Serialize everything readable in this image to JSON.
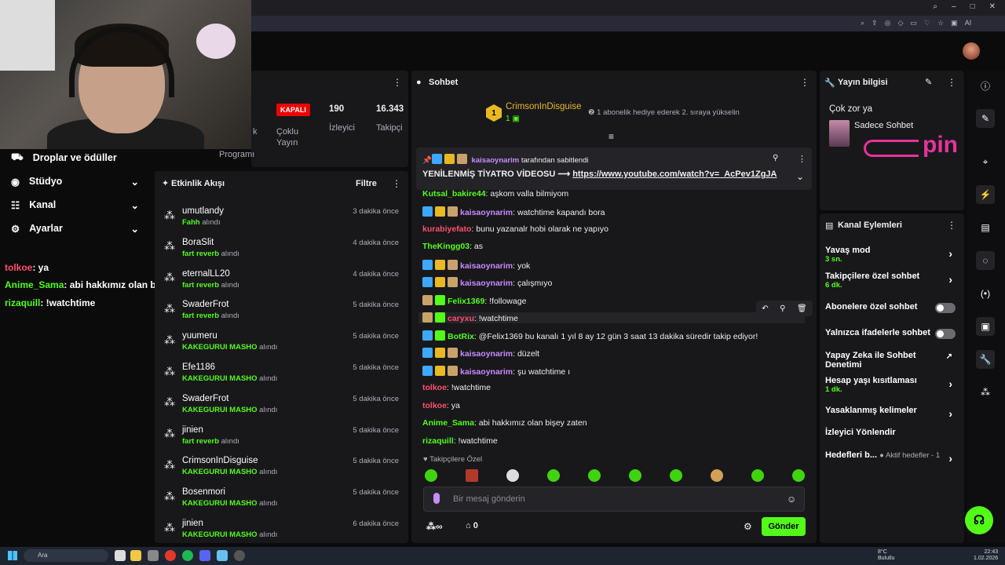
{
  "browser": {
    "window_controls": [
      "–",
      "□",
      "✕"
    ]
  },
  "left_menu": [
    {
      "label": "Droplar ve ödüller"
    },
    {
      "label": "Stüdyo"
    },
    {
      "label": "Kanal"
    },
    {
      "label": "Ayarlar"
    }
  ],
  "overlay_chat": [
    {
      "user": "tolkoe",
      "text": ": ya",
      "color": "#ff4f6b"
    },
    {
      "user": "Anime_Sama",
      "text": ": abi hakkımız olan bişey zaten",
      "color": "#53fc18"
    },
    {
      "user": "rizaquill",
      "text": ": !watchtime",
      "color": "#53fc18"
    }
  ],
  "stats": {
    "status": "KAPALI",
    "viewers_value": "190",
    "viewers_label": "İzleyici",
    "followers_value": "16.343",
    "followers_label": "Takipçi",
    "multi_label": "Çoklu Yayın",
    "program_label": "Programı",
    "partial_k": "k"
  },
  "activity": {
    "title": "Etkinlik Akışı",
    "filter": "Filtre",
    "items": [
      {
        "name": "umutlandy",
        "sub": "Fahh",
        "action": "alındı",
        "time": "3 dakika önce"
      },
      {
        "name": "BoraSlit",
        "sub": "fart reverb",
        "action": "alındı",
        "time": "4 dakika önce"
      },
      {
        "name": "eternalLL20",
        "sub": "fart reverb",
        "action": "alındı",
        "time": "4 dakika önce"
      },
      {
        "name": "SwaderFrot",
        "sub": "fart reverb",
        "action": "alındı",
        "time": "5 dakika önce"
      },
      {
        "name": "yuumeru",
        "sub": "KAKEGURUI MASHO",
        "action": "alındı",
        "time": "5 dakika önce"
      },
      {
        "name": "Efe1186",
        "sub": "KAKEGURUI MASHO",
        "action": "alındı",
        "time": "5 dakika önce"
      },
      {
        "name": "SwaderFrot",
        "sub": "KAKEGURUI MASHO",
        "action": "alındı",
        "time": "5 dakika önce"
      },
      {
        "name": "jinien",
        "sub": "fart reverb",
        "action": "alındı",
        "time": "5 dakika önce"
      },
      {
        "name": "CrimsonInDisguise",
        "sub": "KAKEGURUI MASHO",
        "action": "alındı",
        "time": "5 dakika önce"
      },
      {
        "name": "Bosenmori",
        "sub": "KAKEGURUI MASHO",
        "action": "alındı",
        "time": "5 dakika önce"
      },
      {
        "name": "jinien",
        "sub": "KAKEGURUI MASHO",
        "action": "alındı",
        "time": "6 dakika önce"
      }
    ]
  },
  "chat": {
    "title": "Sohbet",
    "gifter": {
      "rank": "1",
      "name": "CrimsonInDisguise",
      "count": "1",
      "hint": "1 abonelik hediye ederek 2. sıraya yükselin"
    },
    "pinned": {
      "by": "kaisaoynarim",
      "by_suffix": "tarafından sabitlendi",
      "text": "YENİLENMİŞ TİYATRO VİDEOSU ⟶",
      "link": "https://www.youtube.com/watch?v=_AcPev1ZgJA"
    },
    "messages": [
      {
        "user": "Kutsal_bakire44",
        "color": "#53fc18",
        "text": ": aşkom valla bilmiyom",
        "badges": ""
      },
      {
        "user": "kaisaoynarim",
        "color": "#c88bff",
        "text": ": watchtime kapandı bora",
        "badges": "pcs"
      },
      {
        "user": "kurabiyefato",
        "color": "#ff4f6b",
        "text": ": bunu yazanalr hobi olarak ne yapıyo",
        "badges": ""
      },
      {
        "user": "TheKingg03",
        "color": "#53fc18",
        "text": ": as",
        "badges": ""
      },
      {
        "user": "kaisaoynarim",
        "color": "#c88bff",
        "text": ": yok",
        "badges": "pcs"
      },
      {
        "user": "kaisaoynarim",
        "color": "#c88bff",
        "text": ": çalışmıyo",
        "badges": "pcs"
      },
      {
        "user": "Felix1369",
        "color": "#53fc18",
        "text": ": !followage",
        "badges": "sg"
      },
      {
        "user": "caryxu",
        "color": "#ff4f6b",
        "text": ": !watchtime",
        "badges": "sg"
      },
      {
        "user": "BotRix",
        "color": "#53fc18",
        "text": ": @Felix1369 bu kanalı 1 yıl 8 ay 12 gün 3 saat 13 dakika süredir takip ediyor!",
        "badges": "pg"
      },
      {
        "user": "kaisaoynarim",
        "color": "#c88bff",
        "text": ": düzelt",
        "badges": "pcs"
      },
      {
        "user": "kaisaoynarim",
        "color": "#c88bff",
        "text": ": şu watchtime ı",
        "badges": "pcs"
      },
      {
        "user": "tolkoe",
        "color": "#ff4f6b",
        "text": ": !watchtime",
        "badges": ""
      },
      {
        "user": "tolkoe",
        "color": "#ff4f6b",
        "text": ": ya",
        "badges": ""
      },
      {
        "user": "Anime_Sama",
        "color": "#53fc18",
        "text": ": abi hakkımız olan bişey zaten",
        "badges": ""
      },
      {
        "user": "rizaquill",
        "color": "#53fc18",
        "text": ": !watchtime",
        "badges": ""
      }
    ],
    "followers_only": "Takipçilere Özel",
    "input_placeholder": "Bir mesaj gönderin",
    "points": "∞",
    "drops": "0",
    "send": "Gönder"
  },
  "stream_info": {
    "title": "Yayın bilgisi",
    "stream_title": "Çok zor ya",
    "category": "Sadece Sohbet",
    "watermark": "pin"
  },
  "channel_actions": {
    "title": "Kanal Eylemleri",
    "items": [
      {
        "label": "Yavaş mod",
        "sub": "3 sn.",
        "kind": "chev"
      },
      {
        "label": "Takipçilere özel sohbet",
        "sub": "6 dk.",
        "kind": "chev"
      },
      {
        "label": "Abonelere özel sohbet",
        "sub": "",
        "kind": "toggle"
      },
      {
        "label": "Yalnızca ifadelerle sohbet",
        "sub": "",
        "kind": "toggle"
      },
      {
        "label": "Yapay Zeka ile Sohbet Denetimi",
        "sub": "",
        "kind": "ext"
      },
      {
        "label": "Hesap yaşı kısıtlaması",
        "sub": "1 dk.",
        "kind": "chev"
      },
      {
        "label": "Yasaklanmış kelimeler",
        "sub": "",
        "kind": "chev"
      },
      {
        "label": "İzleyici Yönlendir",
        "sub": "",
        "kind": "none"
      },
      {
        "label": "Hedefleri b...",
        "sub": "Aktif hedefler - 1",
        "kind": "chev"
      }
    ]
  },
  "taskbar": {
    "search": "Ara",
    "weather_temp": "8°C",
    "weather_desc": "Bulutlu",
    "time": "22:43",
    "date": "1.02.2026"
  },
  "colors": {
    "accent": "#53fc18",
    "panel": "#18181b",
    "bg": "#0b0b0c"
  }
}
